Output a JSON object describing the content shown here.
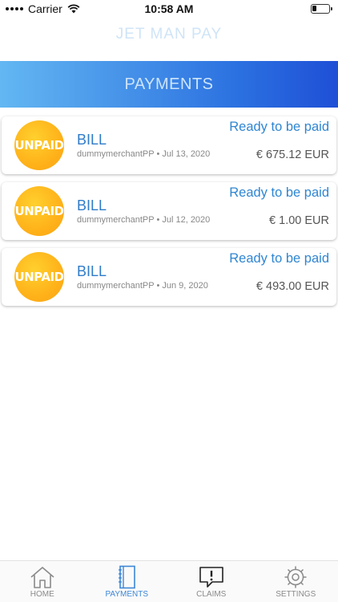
{
  "status_bar": {
    "carrier": "Carrier",
    "time": "10:58 AM"
  },
  "app": {
    "title": "JET MAN PAY"
  },
  "header": {
    "title": "PAYMENTS"
  },
  "payments": [
    {
      "badge": "UNPAID",
      "title": "BILL",
      "meta": "dummymerchantPP • Jul 13, 2020",
      "status": "Ready to be paid",
      "amount": "€ 675.12 EUR"
    },
    {
      "badge": "UNPAID",
      "title": "BILL",
      "meta": "dummymerchantPP • Jul 12, 2020",
      "status": "Ready to be paid",
      "amount": "€ 1.00 EUR"
    },
    {
      "badge": "UNPAID",
      "title": "BILL",
      "meta": "dummymerchantPP • Jun 9, 2020",
      "status": "Ready to be paid",
      "amount": "€ 493.00 EUR"
    }
  ],
  "tabs": [
    {
      "label": "HOME",
      "icon": "home-icon"
    },
    {
      "label": "PAYMENTS",
      "icon": "payments-icon",
      "active": true
    },
    {
      "label": "CLAIMS",
      "icon": "claims-icon"
    },
    {
      "label": "SETTINGS",
      "icon": "settings-icon"
    }
  ],
  "colors": {
    "accent": "#2f7cc9",
    "badge": "#ffb21a",
    "header_start": "#63b7f2",
    "header_end": "#1f4fd6"
  }
}
